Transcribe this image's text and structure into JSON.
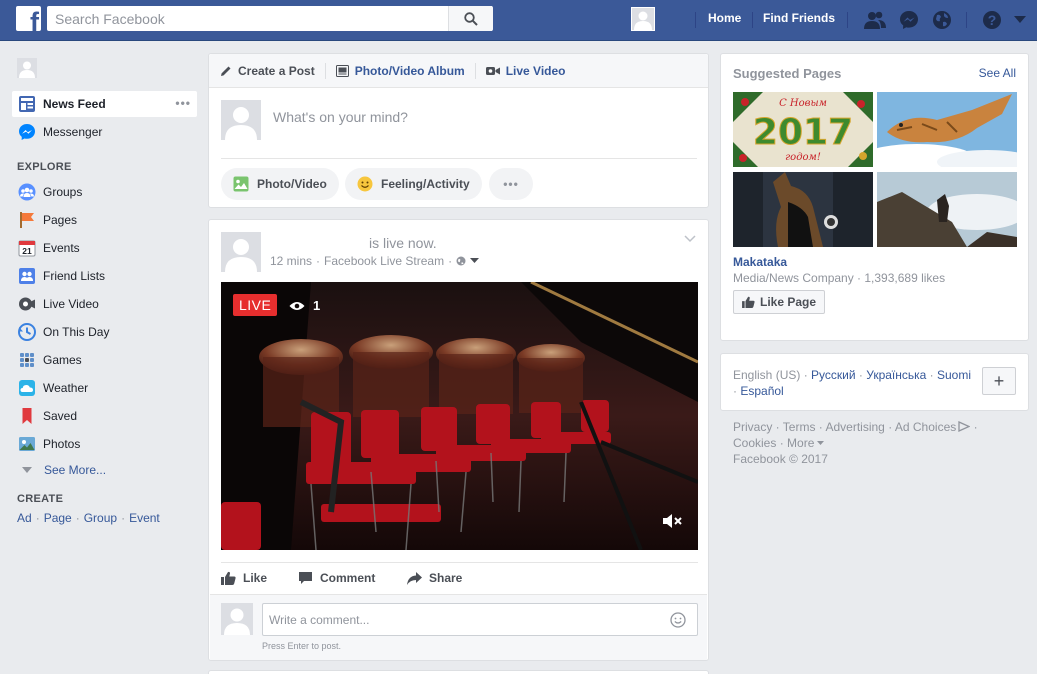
{
  "header": {
    "search_placeholder": "Search Facebook",
    "logo_letter": "f",
    "nav": [
      "Home",
      "Find Friends"
    ]
  },
  "left": {
    "active_item": {
      "label": "News Feed"
    },
    "messenger": "Messenger",
    "explore_title": "EXPLORE",
    "explore_items": [
      "Groups",
      "Pages",
      "Events",
      "Friend Lists",
      "Live Video",
      "On This Day",
      "Games",
      "Weather",
      "Saved",
      "Photos"
    ],
    "events_day": "21",
    "see_more": "See More...",
    "create_title": "CREATE",
    "create_links": [
      "Ad",
      "Page",
      "Group",
      "Event"
    ]
  },
  "composer": {
    "tabs": [
      "Create a Post",
      "Photo/Video Album",
      "Live Video"
    ],
    "placeholder": "What's on your mind?",
    "buttons": [
      "Photo/Video",
      "Feeling/Activity"
    ]
  },
  "post": {
    "headline": "is live now.",
    "time": "12 mins",
    "separator": "·",
    "source": "Facebook Live Stream",
    "live_label": "LIVE",
    "viewers": "1",
    "actions": [
      "Like",
      "Comment",
      "Share"
    ],
    "comment_placeholder": "Write a comment...",
    "press_enter": "Press Enter to post."
  },
  "suggested": {
    "title": "Suggested Pages",
    "see_all": "See All",
    "thumb_text": "2017",
    "thumb_caption_top": "С Новым",
    "thumb_caption_bottom": "годом!",
    "page_name": "Makataka",
    "page_meta": "Media/News Company · 1,393,689 likes",
    "like_button": "Like Page"
  },
  "languages": {
    "current": "English (US)",
    "others": [
      "Русский",
      "Українська",
      "Suomi",
      "Español"
    ],
    "plus": "+"
  },
  "footer": {
    "links": [
      "Privacy",
      "Terms",
      "Advertising",
      "Ad Choices",
      "Cookies",
      "More"
    ],
    "copyright": "Facebook © 2017"
  },
  "colors": {
    "brand_blue": "#3b5998",
    "link_blue": "#365899",
    "live_red": "#e62e2e",
    "background": "#e9ebee"
  }
}
